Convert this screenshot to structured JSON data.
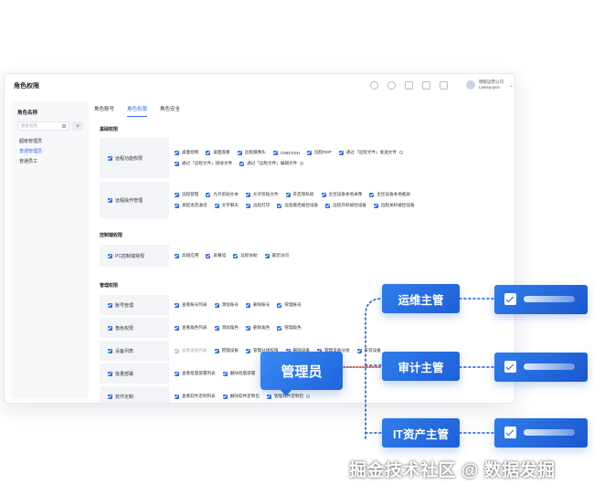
{
  "window": {
    "title": "角色权限",
    "user": {
      "company": "德银运营公司",
      "name": "Liansuoyun"
    }
  },
  "sidebar": {
    "heading": "角色名称",
    "search_placeholder": "搜索名称",
    "add_label": "+",
    "items": [
      {
        "label": "超级管理员",
        "active": false
      },
      {
        "label": "普通管理员",
        "active": true
      },
      {
        "label": "普通员工",
        "active": false
      }
    ]
  },
  "tabs": [
    {
      "label": "角色账号",
      "active": false
    },
    {
      "label": "角色权限",
      "active": true
    },
    {
      "label": "角色安全",
      "active": false
    }
  ],
  "sections": {
    "basic": "基础权限",
    "control": "控制端权限",
    "manage": "管理权限"
  },
  "groups": {
    "remote_func": {
      "label": "远程功能权限",
      "rows": [
        [
          "桌面控制",
          "桌面观看",
          "远程摄像头",
          "CMD/SSH",
          "远程RDP",
          "通过「远程文件」发送文件"
        ],
        [
          "通过「远程文件」接收文件",
          "通过「远程文件」编辑文件"
        ]
      ]
    },
    "remote_ops": {
      "label": "远程操作管理",
      "rows": [
        [
          "远程管理",
          "允许剪贴文本",
          "允许剪贴文件",
          "开启隐私屏",
          "主控设备本地录像",
          "主控设备本地截屏"
        ],
        [
          "发起语音通话",
          "文字聊天",
          "远程打印",
          "远程重启被控设备",
          "远程开机被控设备",
          "远程关机被控设备"
        ]
      ]
    },
    "pc_control": {
      "label": "PC控制端常规",
      "rows": [
        [
          "高级应用",
          "屏幕墙",
          "远程协助",
          "最近访问"
        ]
      ]
    },
    "account": {
      "label": "账号管理",
      "rows": [
        [
          "查看账号列表",
          "添加账号",
          "删除账号",
          "管理账号"
        ]
      ]
    },
    "role": {
      "label": "角色权限",
      "rows": [
        [
          "查看角色列表",
          "添加角色",
          "删除角色",
          "管理角色"
        ]
      ]
    },
    "device": {
      "label": "设备列表",
      "rows": [
        [
          "查看设备列表",
          "管理设备",
          "管理分组权限",
          "删除设备",
          "管理设备分组",
          "安装设备"
        ]
      ]
    },
    "batch": {
      "label": "批量部署",
      "rows": [
        [
          "查看批量部署列表",
          "删除批量部署"
        ]
      ]
    },
    "software": {
      "label": "软件定制",
      "rows": [
        [
          "查看软件定制列表",
          "删除软件定制包",
          "管理软件定制包"
        ]
      ]
    }
  },
  "diagram": {
    "admin": "管理员",
    "roles": [
      "运维主管",
      "审计主管",
      "IT资产主管"
    ],
    "colors": {
      "primary": "#2f7dea",
      "dark": "#1f5fd8",
      "dotted": "#3b6fd8"
    }
  },
  "watermark": "掘金技术社区 @ 数据发掘"
}
